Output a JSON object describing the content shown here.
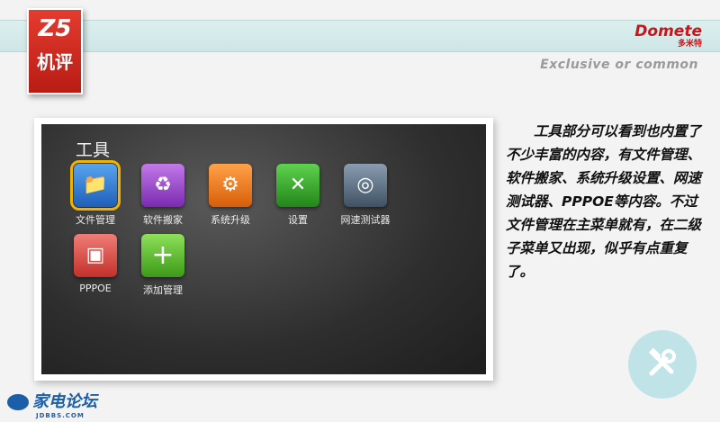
{
  "header": {
    "badge_line1": "Z5",
    "badge_line2": "机评",
    "brand": "Domete",
    "brand_sub": "多米特",
    "tagline": "Exclusive or common"
  },
  "screen": {
    "title": "工具",
    "apps": [
      {
        "label": "文件管理",
        "icon": "file-manager-icon",
        "color": "#2f7fd8",
        "glyph": "📁",
        "selected": true
      },
      {
        "label": "软件搬家",
        "icon": "app-mover-icon",
        "color": "#9a3fc9",
        "glyph": "♻"
      },
      {
        "label": "系统升级",
        "icon": "system-upgrade-icon",
        "color": "#f07a14",
        "glyph": "⚙"
      },
      {
        "label": "设置",
        "icon": "settings-icon",
        "color": "#34a52a",
        "glyph": "✕"
      },
      {
        "label": "网速测试器",
        "icon": "speed-test-icon",
        "color": "#5a6f82",
        "glyph": "◎"
      },
      {
        "label": "PPPOE",
        "icon": "pppoe-icon",
        "color": "#e2504a",
        "glyph": "▣"
      },
      {
        "label": "添加管理",
        "icon": "add-manage-icon",
        "color": "#5cbf2a",
        "glyph": "+"
      }
    ]
  },
  "description": "工具部分可以看到也内置了不少丰富的内容，有文件管理、软件搬家、系统升级设置、网速测试器、PPPOE等内容。不过文件管理在主菜单就有，在二级子菜单又出现，似乎有点重复了。",
  "footer": {
    "forum_name": "家电论坛",
    "forum_sub": "JDBBS.COM"
  }
}
